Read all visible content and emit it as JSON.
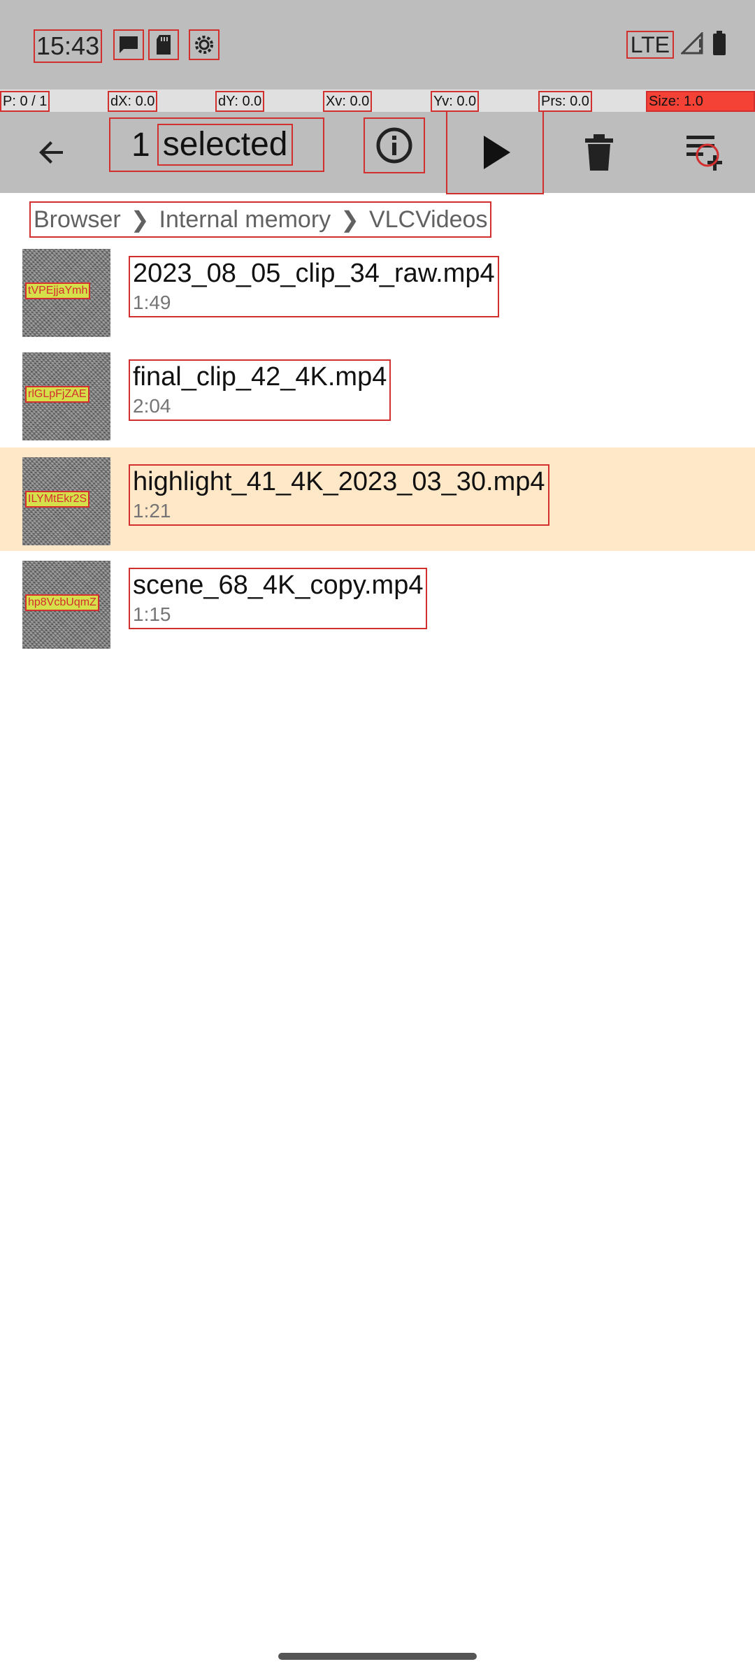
{
  "status_bar": {
    "time": "15:43",
    "icons": [
      "chat-icon",
      "sd-card-icon",
      "gear-icon"
    ],
    "network": "LTE",
    "signal_icon": "signal-icon",
    "battery_icon": "battery-icon"
  },
  "pointer_location": {
    "p": "P: 0 / 1",
    "dx": "dX: 0.0",
    "dy": "dY: 0.0",
    "xv": "Xv: 0.0",
    "yv": "Yv: 0.0",
    "prs": "Prs: 0.0",
    "size": "Size: 1.0"
  },
  "toolbar": {
    "back_icon": "arrow-back-icon",
    "selected_count": "1",
    "selected_label": "selected",
    "info_icon": "info-icon",
    "play_icon": "play-icon",
    "delete_icon": "trash-icon",
    "add_to_playlist_icon": "playlist-add-icon"
  },
  "breadcrumb": {
    "items": [
      "Browser",
      "Internal memory",
      "VLCVideos"
    ]
  },
  "files": [
    {
      "thumb_text": "tVPEjjaYmh",
      "name": "2023_08_05_clip_34_raw.mp4",
      "duration": "1:49",
      "selected": false
    },
    {
      "thumb_text": "rlGLpFjZAE",
      "name": "final_clip_42_4K.mp4",
      "duration": "2:04",
      "selected": false
    },
    {
      "thumb_text": "ILYMtEkr2S",
      "name": "highlight_41_4K_2023_03_30.mp4",
      "duration": "1:21",
      "selected": true
    },
    {
      "thumb_text": "hp8VcbUqmZ",
      "name": "scene_68_4K_copy.mp4",
      "duration": "1:15",
      "selected": false
    }
  ],
  "colors": {
    "toolbar_bg": "#bdbdbd",
    "selected_row_bg": "#ffe8c8",
    "highlight_outline": "#d32f2f"
  }
}
